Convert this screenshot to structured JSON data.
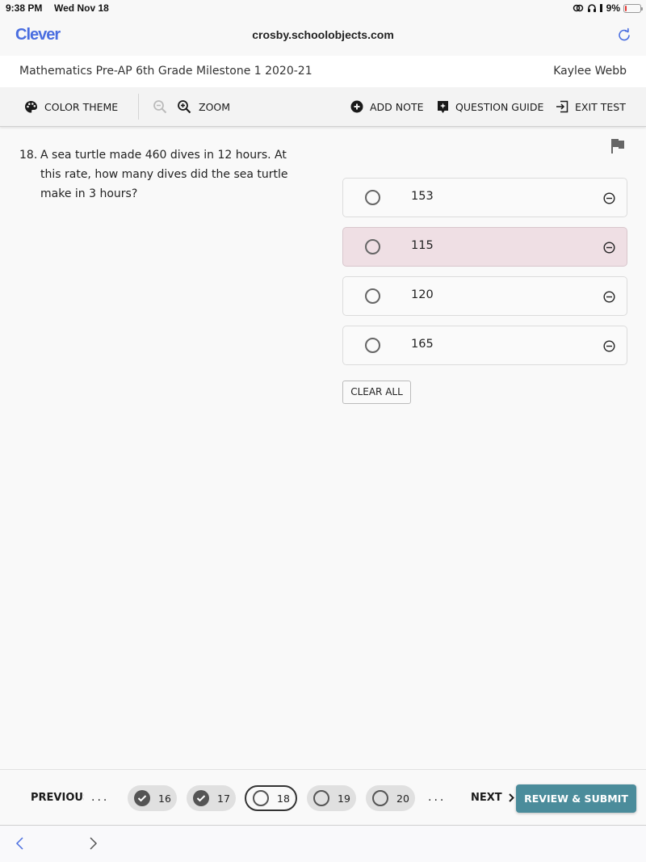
{
  "status_bar": {
    "time": "9:38 PM",
    "date": "Wed Nov 18",
    "battery_percent": "9%",
    "icons": [
      "screen-mirror-icon",
      "headphones-icon",
      "signal-icon",
      "battery-icon"
    ]
  },
  "browser": {
    "brand": "Clever",
    "url": "crosby.schoolobjects.com",
    "reload_icon": "reload-icon",
    "back_icon": "chevron-left-icon",
    "forward_icon": "chevron-right-icon"
  },
  "test": {
    "title": "Mathematics Pre-AP 6th Grade Milestone 1 2020-21",
    "student_name": "Kaylee Webb"
  },
  "toolbar": {
    "color_theme_label": "COLOR THEME",
    "zoom_label": "ZOOM",
    "add_note_label": "ADD NOTE",
    "question_guide_label": "QUESTION GUIDE",
    "exit_test_label": "EXIT TEST"
  },
  "question": {
    "number": "18.",
    "text": "A sea turtle made 460 dives in 12 hours. At this rate, how many dives did the sea turtle make in 3 hours?",
    "flag_icon": "flag-icon"
  },
  "answers": [
    {
      "label": "153",
      "highlighted": false
    },
    {
      "label": "115",
      "highlighted": true
    },
    {
      "label": "120",
      "highlighted": false
    },
    {
      "label": "165",
      "highlighted": false
    }
  ],
  "clear_all_label": "CLEAR ALL",
  "navigation": {
    "previous_label": "PREVIOUS",
    "ellipsis": "...",
    "next_label": "NEXT",
    "submit_label": "REVIEW & SUBMIT",
    "questions": [
      {
        "number": "16",
        "state": "answered"
      },
      {
        "number": "17",
        "state": "answered"
      },
      {
        "number": "18",
        "state": "current"
      },
      {
        "number": "19",
        "state": "unanswered"
      },
      {
        "number": "20",
        "state": "unanswered"
      }
    ]
  },
  "colors": {
    "brand": "#4a6ee0",
    "submit_button": "#4b8c9b",
    "highlighted_answer": "#efdfe4"
  }
}
